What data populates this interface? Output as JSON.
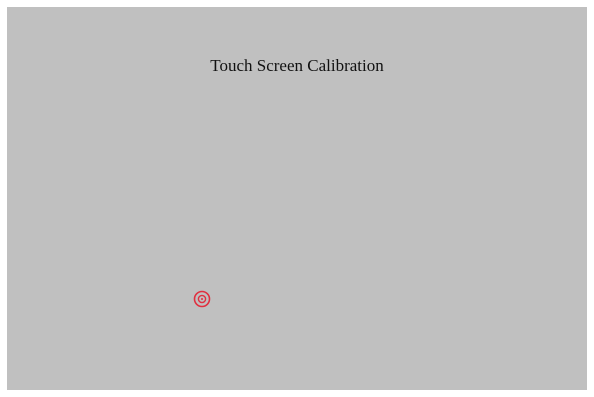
{
  "screen": {
    "title": "Touch Screen Calibration",
    "background_color": "#c0c0c0"
  },
  "calibration_target": {
    "icon": "calibration-crosshair-target-icon",
    "color": "#e03040"
  }
}
